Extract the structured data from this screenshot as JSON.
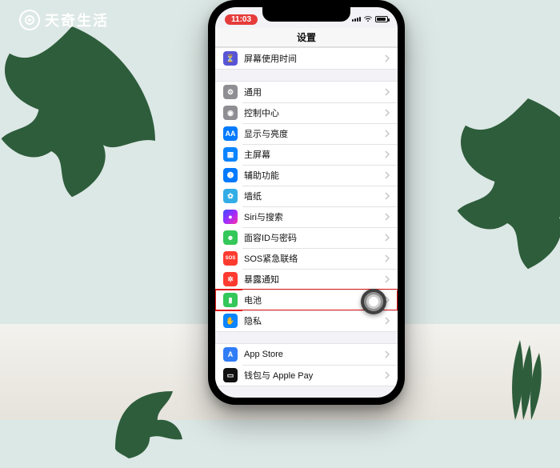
{
  "brand": {
    "name": "天奇生活"
  },
  "status": {
    "time": "11:03",
    "carrier": "􀙇"
  },
  "header": {
    "title": "设置"
  },
  "groups": [
    {
      "id": "g0",
      "rows": [
        {
          "id": "screentime",
          "label": "屏幕使用时间",
          "color": "c-indigo",
          "glyph": "⏳"
        }
      ]
    },
    {
      "id": "g1",
      "rows": [
        {
          "id": "general",
          "label": "通用",
          "color": "c-gray",
          "glyph": "⚙"
        },
        {
          "id": "control",
          "label": "控制中心",
          "color": "c-gray",
          "glyph": "◉"
        },
        {
          "id": "display",
          "label": "显示与亮度",
          "color": "c-blue",
          "glyph": "AA"
        },
        {
          "id": "home",
          "label": "主屏幕",
          "color": "c-bluesq",
          "glyph": "▦"
        },
        {
          "id": "accessibility",
          "label": "辅助功能",
          "color": "c-blue",
          "glyph": "➊"
        },
        {
          "id": "wallpaper",
          "label": "墙纸",
          "color": "c-cyan",
          "glyph": "✿"
        },
        {
          "id": "siri",
          "label": "Siri与搜索",
          "color": "c-siri",
          "glyph": "●"
        },
        {
          "id": "faceid",
          "label": "面容ID与密码",
          "color": "c-green",
          "glyph": "☻"
        },
        {
          "id": "sos",
          "label": "SOS紧急联络",
          "color": "c-red",
          "glyph": "SOS"
        },
        {
          "id": "exposure",
          "label": "暴露通知",
          "color": "c-redcircle",
          "glyph": "✲"
        },
        {
          "id": "battery",
          "label": "电池",
          "color": "c-green",
          "glyph": "▮",
          "highlight": true
        },
        {
          "id": "privacy",
          "label": "隐私",
          "color": "c-bluehand",
          "glyph": "✋"
        }
      ]
    },
    {
      "id": "g2",
      "rows": [
        {
          "id": "appstore",
          "label": "App Store",
          "color": "c-appstore",
          "glyph": "A"
        },
        {
          "id": "wallet",
          "label": "钱包与 Apple Pay",
          "color": "c-wallet",
          "glyph": "▭"
        }
      ]
    }
  ]
}
